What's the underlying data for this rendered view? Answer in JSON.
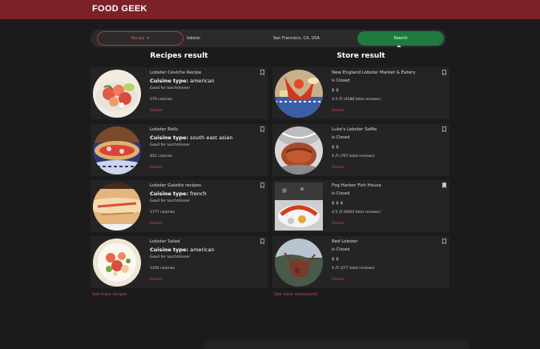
{
  "app": {
    "logo": "FOOD GEEK"
  },
  "search": {
    "type_label": "Recipe",
    "type_caret": "▼",
    "query": "lobster",
    "location": "San Francisco, CA, USA",
    "button": "Search"
  },
  "recipes": {
    "heading": "Recipes result",
    "see_more": "See more recipes",
    "cuisine_prefix": "Cuisine type:",
    "items": [
      {
        "title": "Lobster Ceviche Recipe",
        "cuisine": "american",
        "meal": "Good for lunch/dinner",
        "calories": "579 calories",
        "details": "Details",
        "image_icon": "ceviche-photo"
      },
      {
        "title": "Lobster Rolls",
        "cuisine": "south east asian",
        "meal": "Good for lunch/dinner",
        "calories": "832 calories",
        "details": "Details",
        "image_icon": "lobster-roll-photo"
      },
      {
        "title": "Lobster Galette recipes",
        "cuisine": "french",
        "meal": "Good for lunch/dinner",
        "calories": "1777 calories",
        "details": "Details",
        "image_icon": "galette-photo"
      },
      {
        "title": "Lobster Salad",
        "cuisine": "american",
        "meal": "Good for lunch/dinner",
        "calories": "1204 calories",
        "details": "Details",
        "image_icon": "salad-photo"
      }
    ]
  },
  "stores": {
    "heading": "Store result",
    "see_more": "See more restaurants",
    "items": [
      {
        "name": "New England Lobster Market & Eatery",
        "status": "is Closed",
        "price": "$ $",
        "rating": "4.5 /5 (4588 total reviews)",
        "details": "Details",
        "bookmarked": false
      },
      {
        "name": "Luke's Lobster SoMa",
        "status": "is Closed",
        "price": "$ $",
        "rating": "4 /5 (767 total reviews)",
        "details": "Details",
        "bookmarked": false
      },
      {
        "name": "Fog Harbor Fish House",
        "status": "is Closed",
        "price": "$ $ $",
        "rating": "4.5 /5 (6904 total reviews)",
        "details": "Details",
        "bookmarked": true
      },
      {
        "name": "Red Lobster",
        "status": "is Closed",
        "price": "$ $",
        "rating": "4 /5 (277 total reviews)",
        "details": "Details",
        "bookmarked": false
      }
    ]
  },
  "colors": {
    "brand": "#7c2127",
    "accent": "#d0454f",
    "search_button": "#1f7a42"
  }
}
